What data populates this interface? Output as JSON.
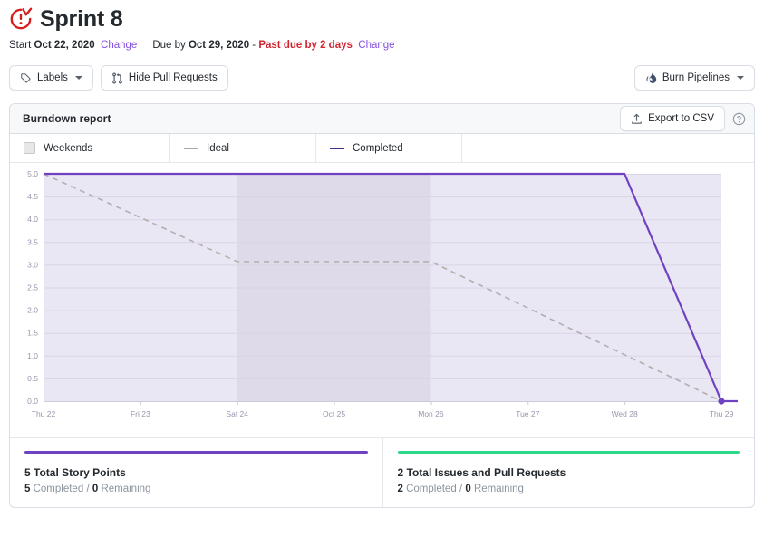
{
  "header": {
    "icon": "sprint-overdue-icon",
    "title": "Sprint 8",
    "start_label": "Start",
    "start_date": "Oct 22, 2020",
    "start_change": "Change",
    "due_label": "Due by",
    "due_date": "Oct 29, 2020",
    "due_separator": " - ",
    "overdue": "Past due by 2 days",
    "due_change": "Change"
  },
  "toolbar": {
    "labels_button": "Labels",
    "labels_icon": "tag-icon",
    "hide_pr_button": "Hide Pull Requests",
    "hide_pr_icon": "git-pull-request-icon",
    "burn_pipelines_button": "Burn Pipelines",
    "burn_pipelines_icon": "flame-icon"
  },
  "report": {
    "card_title": "Burndown report",
    "export_button": "Export to CSV",
    "export_icon": "upload-icon",
    "help_icon": "question-circle-icon",
    "legend": [
      {
        "label": "Weekends",
        "marker": "box",
        "color": "#e7e7e7"
      },
      {
        "label": "Ideal",
        "marker": "line",
        "color": "#a8a8a8"
      },
      {
        "label": "Completed",
        "marker": "line",
        "color": "#4a2a8a"
      },
      {
        "label": "",
        "marker": "none",
        "color": ""
      }
    ]
  },
  "chart_data": {
    "type": "line",
    "title": "Burndown report",
    "xlabel": "",
    "ylabel": "",
    "grid": true,
    "legend_position": "top",
    "x": [
      "Thu 22",
      "Fri 23",
      "Sat 24",
      "Oct 25",
      "Mon 26",
      "Tue 27",
      "Wed 28",
      "Thu 29"
    ],
    "xlim": [
      0,
      7
    ],
    "ylim": [
      0,
      5
    ],
    "yticks": [
      "0.0",
      "0.5",
      "1.0",
      "1.5",
      "2.0",
      "2.5",
      "3.0",
      "3.5",
      "4.0",
      "4.5",
      "5.0"
    ],
    "plot_background": "#eae7f4",
    "weekend_band": {
      "from": "Sat 24",
      "to": "Mon 26",
      "color": "#dedae9"
    },
    "series": [
      {
        "name": "Ideal",
        "color": "#b3aeae",
        "style": "dashed",
        "values": [
          5.0,
          4.04,
          3.07,
          3.07,
          3.07,
          2.05,
          1.02,
          0.0
        ]
      },
      {
        "name": "Completed",
        "color": "#6f42c1",
        "style": "solid",
        "values": [
          5.0,
          5.0,
          5.0,
          5.0,
          5.0,
          5.0,
          5.0,
          0.0
        ],
        "marker_at": "Thu 29"
      }
    ]
  },
  "summary": [
    {
      "accent": "#6f42c1",
      "title": "5 Total Story Points",
      "completed_value": "5",
      "completed_label": "Completed",
      "separator": "/",
      "remaining_value": "0",
      "remaining_label": "Remaining"
    },
    {
      "accent": "#2cd889",
      "title": "2 Total Issues and Pull Requests",
      "completed_value": "2",
      "completed_label": "Completed",
      "separator": "/",
      "remaining_value": "0",
      "remaining_label": "Remaining"
    }
  ]
}
